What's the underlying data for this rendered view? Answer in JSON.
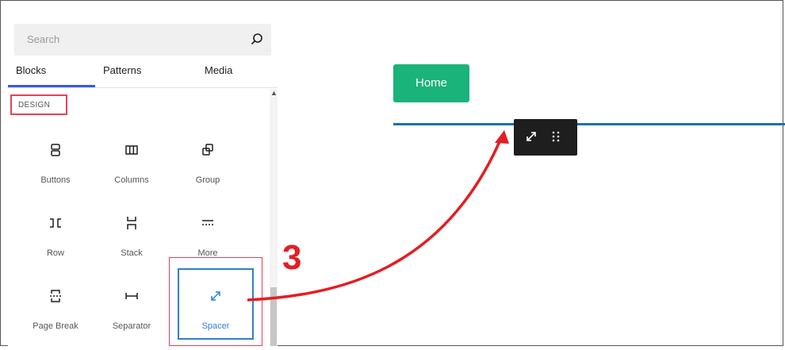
{
  "inserter": {
    "search": {
      "placeholder": "Search"
    },
    "tabs": [
      {
        "label": "Blocks"
      },
      {
        "label": "Patterns"
      },
      {
        "label": "Media"
      }
    ],
    "category": "DESIGN",
    "blocks": [
      {
        "label": "Buttons",
        "icon": "buttons-icon"
      },
      {
        "label": "Columns",
        "icon": "columns-icon"
      },
      {
        "label": "Group",
        "icon": "group-icon"
      },
      {
        "label": "Row",
        "icon": "row-icon"
      },
      {
        "label": "Stack",
        "icon": "stack-icon"
      },
      {
        "label": "More",
        "icon": "more-icon"
      },
      {
        "label": "Page Break",
        "icon": "page-break-icon"
      },
      {
        "label": "Separator",
        "icon": "separator-icon"
      },
      {
        "label": "Spacer",
        "icon": "spacer-icon"
      }
    ]
  },
  "canvas": {
    "home_button": "Home"
  },
  "annotation": {
    "step_number": "3"
  },
  "colors": {
    "accent": "#3858e9",
    "highlight_red": "#e3425a",
    "selection_blue": "#2e7fd4",
    "home_green": "#1ab37a",
    "spacer_line": "#1b6fb8",
    "toolbar_bg": "#1e1e1e",
    "arrow_red": "#e31e24"
  }
}
